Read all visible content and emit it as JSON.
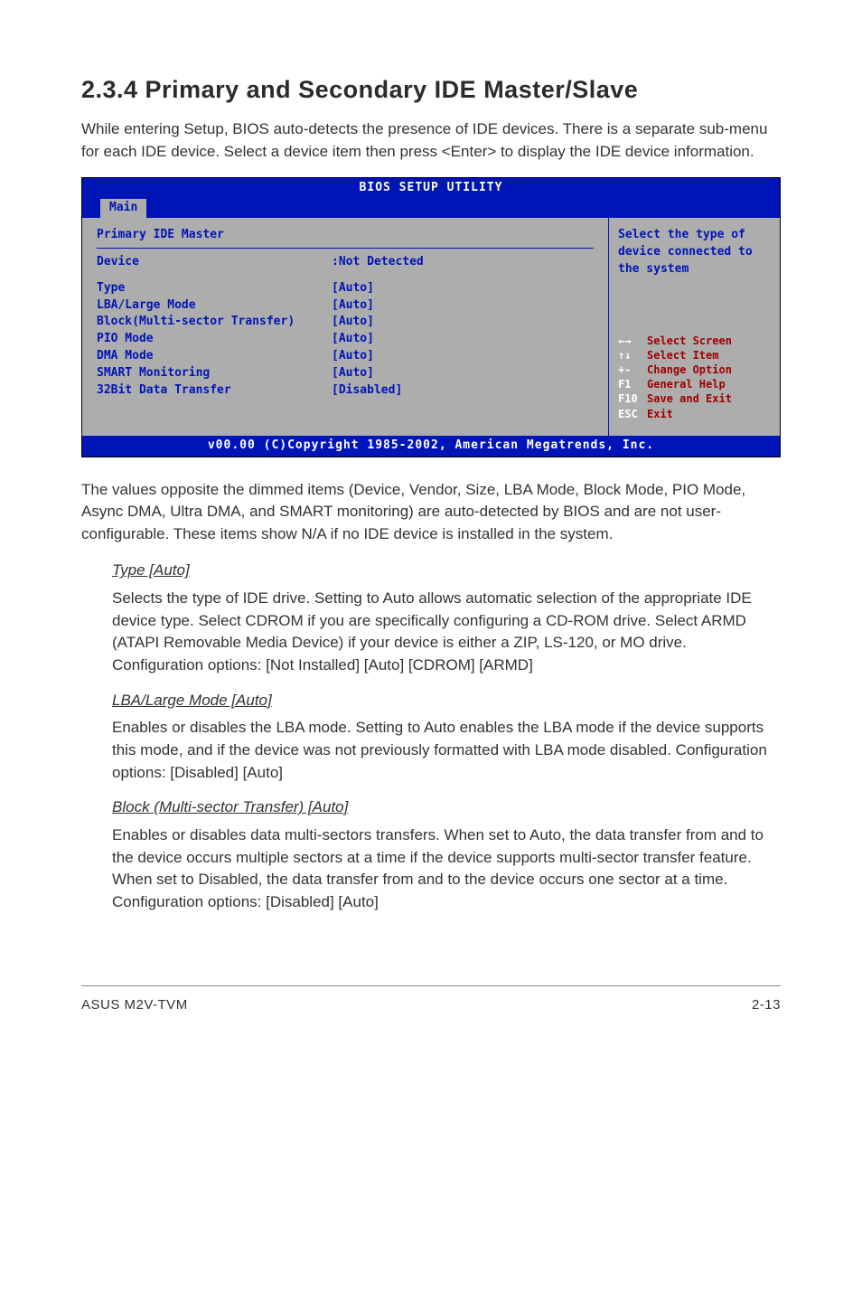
{
  "section": {
    "number": "2.3.4",
    "title": "Primary and Secondary IDE Master/Slave",
    "heading_full": "2.3.4   Primary and Secondary IDE Master/Slave"
  },
  "intro": "While entering Setup, BIOS auto-detects the presence of IDE devices. There is a separate sub-menu for each IDE device. Select a device item then press <Enter> to display the IDE device information.",
  "bios": {
    "header": "BIOS SETUP UTILITY",
    "tab": "Main",
    "left_title": "Primary IDE Master",
    "device_label": "Device",
    "device_value": ":Not Detected",
    "fields": [
      {
        "label": "Type",
        "value": "[Auto]"
      },
      {
        "label": "LBA/Large Mode",
        "value": "[Auto]"
      },
      {
        "label": "Block(Multi-sector Transfer)",
        "value": "[Auto]"
      },
      {
        "label": "PIO Mode",
        "value": "[Auto]"
      },
      {
        "label": "DMA Mode",
        "value": "[Auto]"
      },
      {
        "label": "SMART Monitoring",
        "value": "[Auto]"
      },
      {
        "label": "32Bit Data Transfer",
        "value": "[Disabled]"
      }
    ],
    "right_help": "Select the type of device connected to the system",
    "keys": [
      {
        "k": "←→",
        "d": "Select Screen"
      },
      {
        "k": "↑↓",
        "d": "Select Item"
      },
      {
        "k": "+-",
        "d": "Change Option"
      },
      {
        "k": "F1",
        "d": "General Help"
      },
      {
        "k": "F10",
        "d": "Save and Exit"
      },
      {
        "k": "ESC",
        "d": "Exit"
      }
    ],
    "footer": "v00.00 (C)Copyright 1985-2002, American Megatrends, Inc."
  },
  "after_bios": "The values opposite the dimmed items (Device, Vendor, Size, LBA Mode, Block Mode, PIO Mode, Async DMA, Ultra DMA, and SMART monitoring) are auto-detected by BIOS and are not user-configurable. These items show N/A if no IDE device is installed in the system.",
  "items": {
    "type": {
      "h": "Type [Auto]",
      "p": "Selects the type of IDE drive. Setting to Auto allows automatic selection of the appropriate IDE device type. Select CDROM if you are specifically configuring a CD-ROM drive. Select ARMD (ATAPI Removable Media Device) if your device is either a ZIP, LS-120, or MO drive. Configuration options: [Not Installed] [Auto] [CDROM] [ARMD]"
    },
    "lba": {
      "h": "LBA/Large Mode [Auto]",
      "p": "Enables or disables the LBA mode. Setting to Auto enables the LBA mode if the device supports this mode, and if the device was not previously formatted with LBA mode disabled. Configuration options: [Disabled] [Auto]"
    },
    "block": {
      "h": "Block (Multi-sector Transfer) [Auto]",
      "p": "Enables or disables data multi-sectors transfers. When set to Auto, the data transfer from and to the device occurs multiple sectors at a time if the device supports multi-sector transfer feature. When set to Disabled, the data transfer from and to the device occurs one sector at a time. Configuration options: [Disabled] [Auto]"
    }
  },
  "footer": {
    "left": "ASUS M2V-TVM",
    "right": "2-13"
  }
}
